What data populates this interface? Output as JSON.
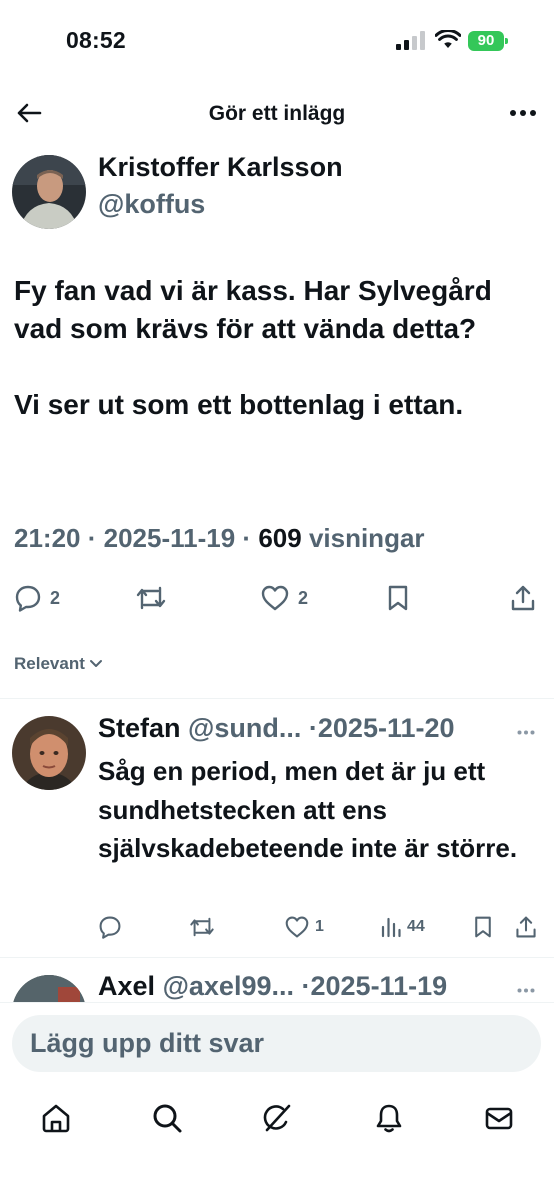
{
  "status_bar": {
    "time": "08:52",
    "battery": "90"
  },
  "header": {
    "title": "Gör ett inlägg"
  },
  "tweet": {
    "author_name": "Kristoffer Karlsson",
    "author_handle": "@koffus",
    "text_line1": "Fy fan vad vi är kass. Har Sylvegård vad som krävs för att vända detta?",
    "text_line2": "Vi ser ut som ett bottenlag i ettan.",
    "time": "21:20",
    "date": "2025-11-19",
    "views_count": "609",
    "views_label": "visningar",
    "reply_count": "2",
    "like_count": "2"
  },
  "sort": {
    "label": "Relevant"
  },
  "replies": [
    {
      "name": "Stefan",
      "handle": "@sund...",
      "date": "2025-11-20",
      "text": "Såg en period, men det är ju ett sundhetstecken att ens självskadebeteende inte är större.",
      "like_count": "1",
      "views_count": "44"
    },
    {
      "name": "Axel",
      "handle": "@axel99...",
      "date": "2025-11-19"
    }
  ],
  "composer": {
    "placeholder": "Lägg upp ditt svar"
  },
  "nav": [
    "home-icon",
    "search-icon",
    "grok-icon",
    "notifications-icon",
    "messages-icon"
  ],
  "colors": {
    "text": "#0f1419",
    "secondary": "#536471",
    "battery": "#34c759",
    "composer_bg": "#eff3f4"
  }
}
